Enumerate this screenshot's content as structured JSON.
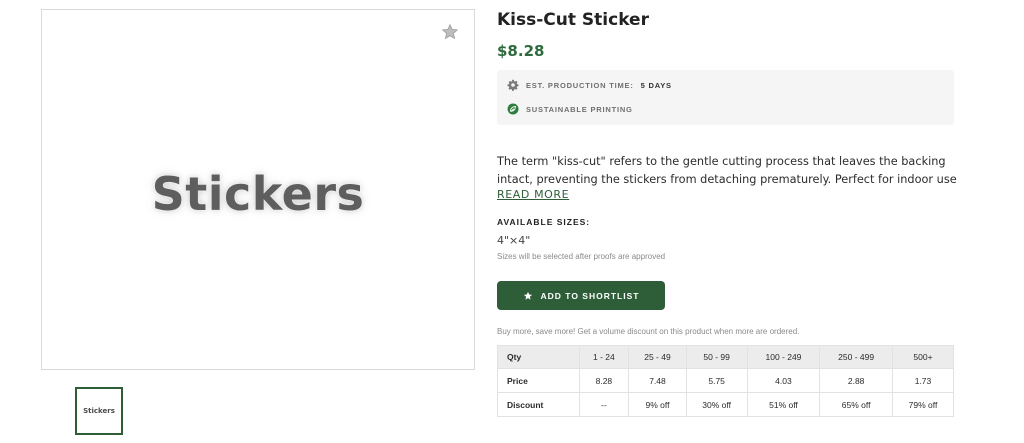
{
  "gallery": {
    "main_image_text": "Stickers",
    "thumbnail_text": "Stickers",
    "favorite_icon": "star-icon"
  },
  "product": {
    "title": "Kiss-Cut Sticker",
    "price": "$8.28",
    "features": [
      {
        "icon": "gear-icon",
        "label": "EST. PRODUCTION TIME:",
        "value": "5 DAYS"
      },
      {
        "icon": "leaf-icon",
        "label": "SUSTAINABLE PRINTING",
        "value": ""
      }
    ],
    "description_lines": [
      "The term \"kiss-cut\" refers to the gentle cutting process that leaves the backing",
      "intact, preventing the stickers from detaching prematurely. Perfect for indoor use, it..."
    ],
    "read_more": "READ MORE",
    "sizes_label": "AVAILABLE SIZES:",
    "size_value": "4\"×4\"",
    "size_note": "Sizes will be selected after proofs are approved",
    "shortlist_button": "ADD TO SHORTLIST",
    "volume_note": "Buy more, save more! Get a volume discount on this product when more are ordered."
  },
  "price_table": {
    "header": [
      "Qty",
      "1 - 24",
      "25 - 49",
      "50 - 99",
      "100 - 249",
      "250 - 499",
      "500+"
    ],
    "rows": [
      [
        "Price",
        "8.28",
        "7.48",
        "5.75",
        "4.03",
        "2.88",
        "1.73"
      ],
      [
        "Discount",
        "--",
        "9% off",
        "30% off",
        "51% off",
        "65% off",
        "79% off"
      ]
    ]
  },
  "colors": {
    "brand_green": "#2e5e38",
    "price_green": "#2e6b3c"
  }
}
